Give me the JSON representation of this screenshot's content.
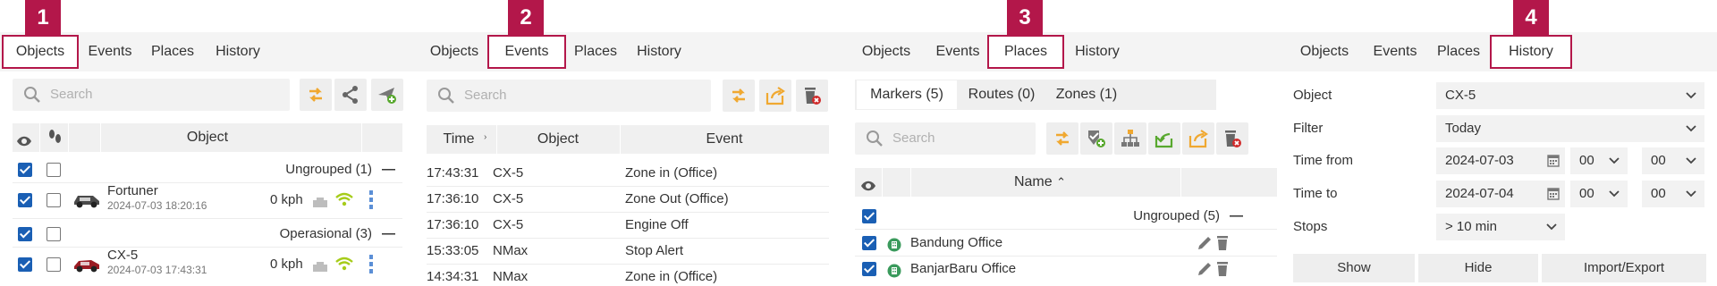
{
  "badges": [
    "1",
    "2",
    "3",
    "4"
  ],
  "tabs": [
    "Objects",
    "Events",
    "Places",
    "History"
  ],
  "colors": {
    "accent": "#b3174a",
    "checkbox": "#1a5fb4",
    "orange": "#f0a830",
    "green": "#58a82e",
    "red": "#d12b2b",
    "wifi": "#a6cc1a"
  },
  "objects": {
    "search_placeholder": "Search",
    "header_object": "Object",
    "groups": [
      {
        "label": "Ungrouped (1)",
        "collapse": "—",
        "items": [
          {
            "name": "Fortuner",
            "time": "2024-07-03 18:20:16",
            "speed": "0 kph"
          }
        ]
      },
      {
        "label": "Operasional (3)",
        "collapse": "—",
        "items": [
          {
            "name": "CX-5",
            "time": "2024-07-03 17:43:31",
            "speed": "0 kph"
          }
        ]
      }
    ]
  },
  "events": {
    "search_placeholder": "Search",
    "headers": {
      "time": "Time",
      "object": "Object",
      "event": "Event"
    },
    "rows": [
      {
        "time": "17:43:31",
        "object": "CX-5",
        "event": "Zone in (Office)"
      },
      {
        "time": "17:36:10",
        "object": "CX-5",
        "event": "Zone Out (Office)"
      },
      {
        "time": "17:36:10",
        "object": "CX-5",
        "event": "Engine Off"
      },
      {
        "time": "15:33:05",
        "object": "NMax",
        "event": "Stop Alert"
      },
      {
        "time": "14:34:31",
        "object": "NMax",
        "event": "Zone in (Office)"
      }
    ]
  },
  "places": {
    "subtabs": [
      "Markers (5)",
      "Routes (0)",
      "Zones (1)"
    ],
    "search_placeholder": "Search",
    "header_name": "Name",
    "group": {
      "label": "Ungrouped (5)",
      "collapse": "—"
    },
    "items": [
      "Bandung Office",
      "BanjarBaru Office"
    ]
  },
  "history": {
    "labels": {
      "object": "Object",
      "filter": "Filter",
      "time_from": "Time from",
      "time_to": "Time to",
      "stops": "Stops"
    },
    "values": {
      "object": "CX-5",
      "filter": "Today",
      "date_from": "2024-07-03",
      "hour_from": "00",
      "minute_from": "00",
      "date_to": "2024-07-04",
      "hour_to": "00",
      "minute_to": "00",
      "stops": "> 10 min"
    },
    "buttons": {
      "show": "Show",
      "hide": "Hide",
      "import_export": "Import/Export"
    }
  }
}
